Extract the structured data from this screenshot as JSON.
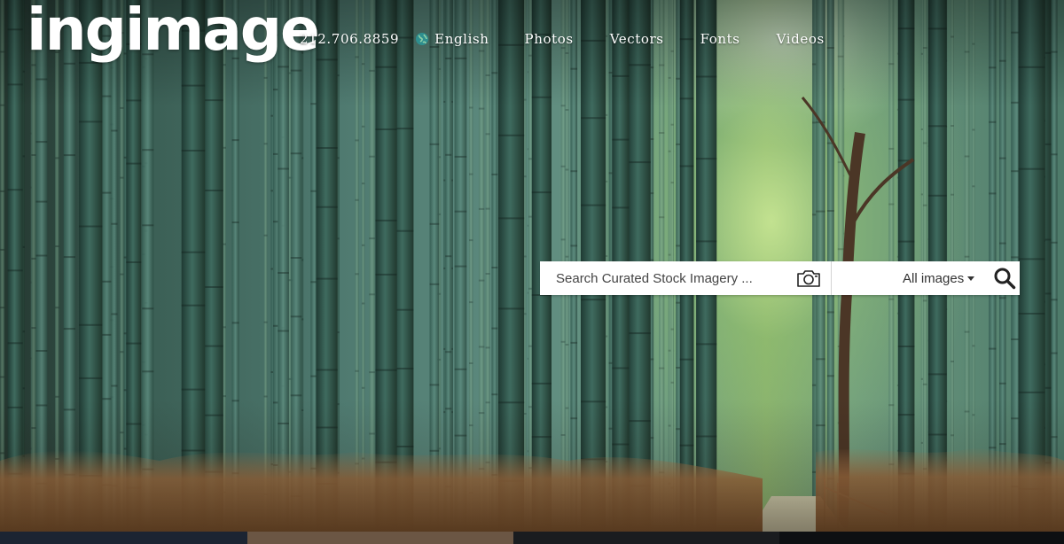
{
  "header": {
    "logo": "ingimage",
    "phone": "212.706.8859",
    "language": {
      "label": "English",
      "icon": "globe-icon"
    },
    "nav": [
      {
        "label": "Photos"
      },
      {
        "label": "Vectors"
      },
      {
        "label": "Fonts"
      },
      {
        "label": "Videos"
      }
    ]
  },
  "search": {
    "placeholder": "Search Curated Stock Imagery ...",
    "camera_icon": "camera-icon",
    "filter": {
      "selected": "All images"
    },
    "submit_icon": "magnifier-icon"
  },
  "colors": {
    "search_bg": "#ffffff",
    "text_light": "#ffffff",
    "text_dark": "#333333"
  }
}
